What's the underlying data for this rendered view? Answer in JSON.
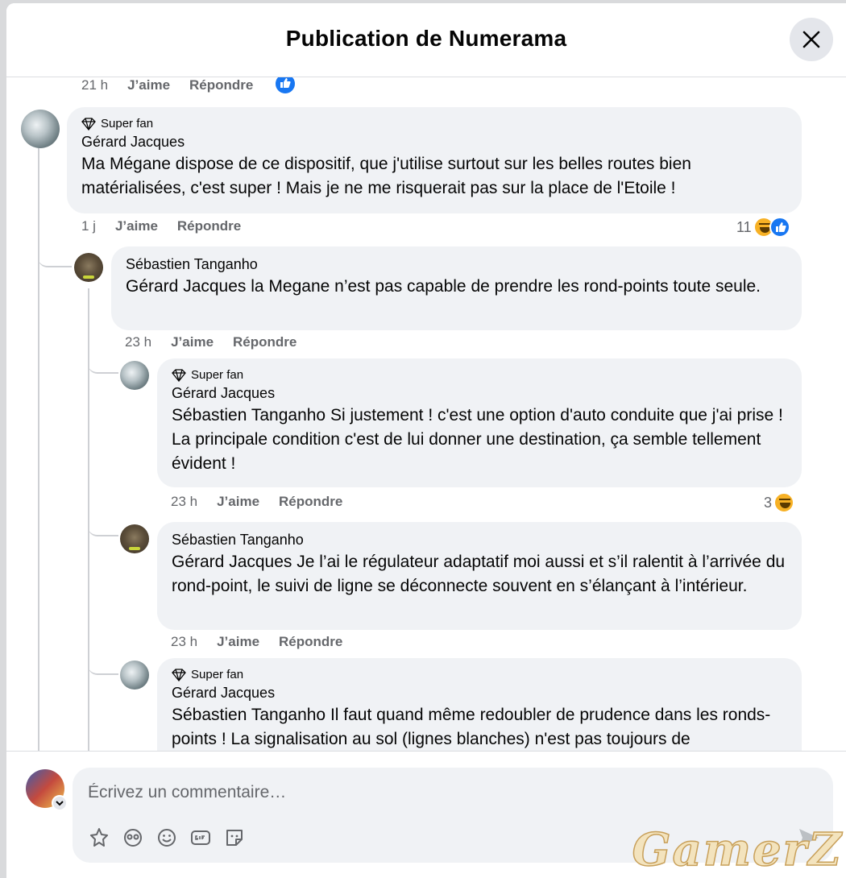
{
  "header": {
    "title": "Publication de Numerama"
  },
  "top_meta": {
    "time": "21 h",
    "like": "J’aime",
    "reply": "Répondre"
  },
  "comments": [
    {
      "badge": "Super fan",
      "author": "Gérard Jacques",
      "text": "Ma Mégane dispose de ce dispositif, que j'utilise surtout sur les belles routes bien matérialisées, c'est super ! Mais je ne me risquerait pas sur la place de l'Etoile !",
      "time": "1 j",
      "like": "J’aime",
      "reply": "Répondre",
      "reaction_count": "11"
    },
    {
      "author": "Sébastien Tanganho",
      "mention": "Gérard Jacques",
      "text": " la Megane n’est pas capable de prendre les rond-points toute seule.",
      "time": "23 h",
      "like": "J’aime",
      "reply": "Répondre"
    },
    {
      "badge": "Super fan",
      "author": "Gérard Jacques",
      "mention": "Sébastien Tanganho",
      "text": " Si justement ! c'est une option d'auto conduite que j'ai prise ! La principale condition c'est de lui donner une destination, ça semble tellement évident !",
      "time": "23 h",
      "like": "J’aime",
      "reply": "Répondre",
      "reaction_count": "3"
    },
    {
      "author": "Sébastien Tanganho",
      "mention": "Gérard Jacques",
      "text": " Je l’ai le régulateur adaptatif moi aussi et s’il ralentit à l’arrivée du rond-point, le suivi de ligne se déconnecte souvent en s’élançant à l’intérieur.",
      "time": "23 h",
      "like": "J’aime",
      "reply": "Répondre"
    },
    {
      "badge": "Super fan",
      "author": "Gérard Jacques",
      "mention": "Sébastien Tanganho",
      "text": " Il faut quand même redoubler de prudence dans les ronds-points ! La signalisation au sol (lignes blanches) n'est pas toujours de"
    }
  ],
  "composer": {
    "placeholder": "Écrivez un commentaire…"
  },
  "icons": [
    "close-icon",
    "diamond-icon",
    "like-icon",
    "haha-icon",
    "avatar-sticker-icon",
    "mask-icon",
    "smiley-icon",
    "gif-icon",
    "sticker-icon",
    "send-icon"
  ],
  "watermark": "GamerZ",
  "colors": {
    "bubble": "#f0f2f5",
    "secondary_text": "#65676b",
    "like_blue": "#1877f2",
    "haha_yellow": "#f7b125"
  }
}
